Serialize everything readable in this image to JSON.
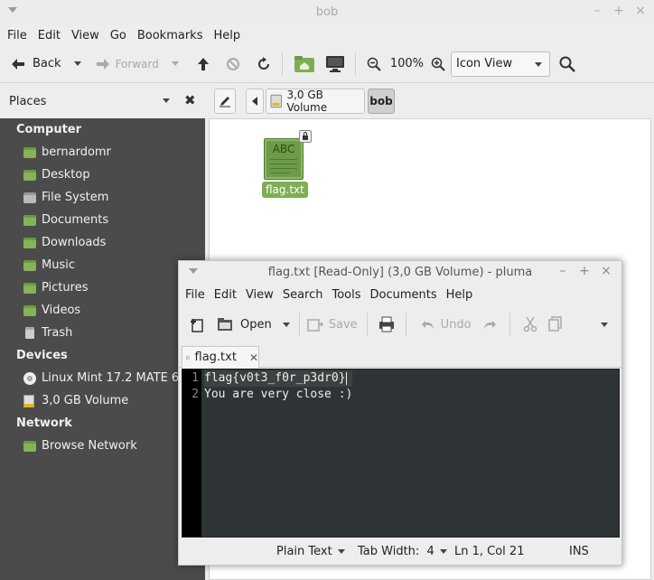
{
  "caja": {
    "title": "bob",
    "title_buttons": [
      "–",
      "+",
      "×"
    ],
    "menu": [
      "File",
      "Edit",
      "View",
      "Go",
      "Bookmarks",
      "Help"
    ],
    "toolbar": {
      "back_label": "Back",
      "forward_label": "Forward",
      "zoom_level": "100%",
      "view_mode": "Icon View"
    },
    "places_label": "Places",
    "path": {
      "volume_label": "3,0 GB Volume",
      "current": "bob"
    },
    "sidebar": {
      "computer_head": "Computer",
      "computer_items": [
        "bernardomr",
        "Desktop",
        "File System",
        "Documents",
        "Downloads",
        "Music",
        "Pictures",
        "Videos",
        "Trash"
      ],
      "devices_head": "Devices",
      "device_items": [
        "Linux Mint 17.2 MATE 6...",
        "3,0 GB Volume"
      ],
      "network_head": "Network",
      "network_items": [
        "Browse Network"
      ]
    },
    "file": {
      "name": "flag.txt",
      "thumb_text": "ABC"
    }
  },
  "pluma": {
    "title": "flag.txt [Read-Only] (3,0 GB Volume) - pluma",
    "title_buttons": [
      "–",
      "+",
      "×"
    ],
    "menu": [
      "File",
      "Edit",
      "View",
      "Search",
      "Tools",
      "Documents",
      "Help"
    ],
    "toolbar": {
      "open_label": "Open",
      "save_label": "Save",
      "undo_label": "Undo"
    },
    "tab_label": "flag.txt",
    "lines": [
      {
        "num": "1",
        "text": "flag{v0t3_f0r_p3dr0}"
      },
      {
        "num": "2",
        "text": "You are very close :)"
      }
    ],
    "status": {
      "syntax": "Plain Text",
      "tab_width": "Tab Width:  4",
      "position": "Ln 1, Col 21",
      "mode": "INS"
    }
  }
}
